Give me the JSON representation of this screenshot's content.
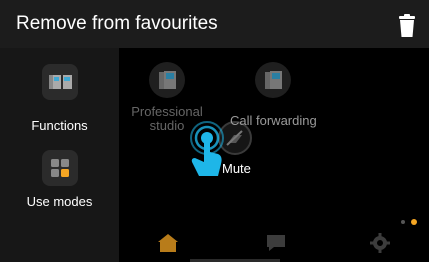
{
  "header": {
    "title": "Remove from favourites",
    "trash_icon": "trash-icon"
  },
  "sidebar": {
    "items": [
      {
        "label": "Functions",
        "icon": "intercom-devices-icon"
      },
      {
        "label": "Use modes",
        "icon": "use-modes-grid-icon"
      }
    ]
  },
  "favourites": [
    {
      "label_line1": "Professional",
      "label_line2": "studio",
      "icon": "intercom-phone-icon"
    },
    {
      "label_line1": "",
      "label_line2": "",
      "icon": "intercom-phone-icon"
    },
    {
      "label": "Call forwarding",
      "icon": "call-forwarding-icon"
    },
    {
      "label": "Mute",
      "icon": "mute-speaker-icon"
    }
  ],
  "bottom_nav": {
    "items": [
      "home-icon",
      "chat-icon",
      "settings-gear-icon"
    ]
  },
  "colors": {
    "accent": "#f5a623",
    "highlight": "#1eb6e8",
    "header_bg": "#1c1c1c"
  }
}
